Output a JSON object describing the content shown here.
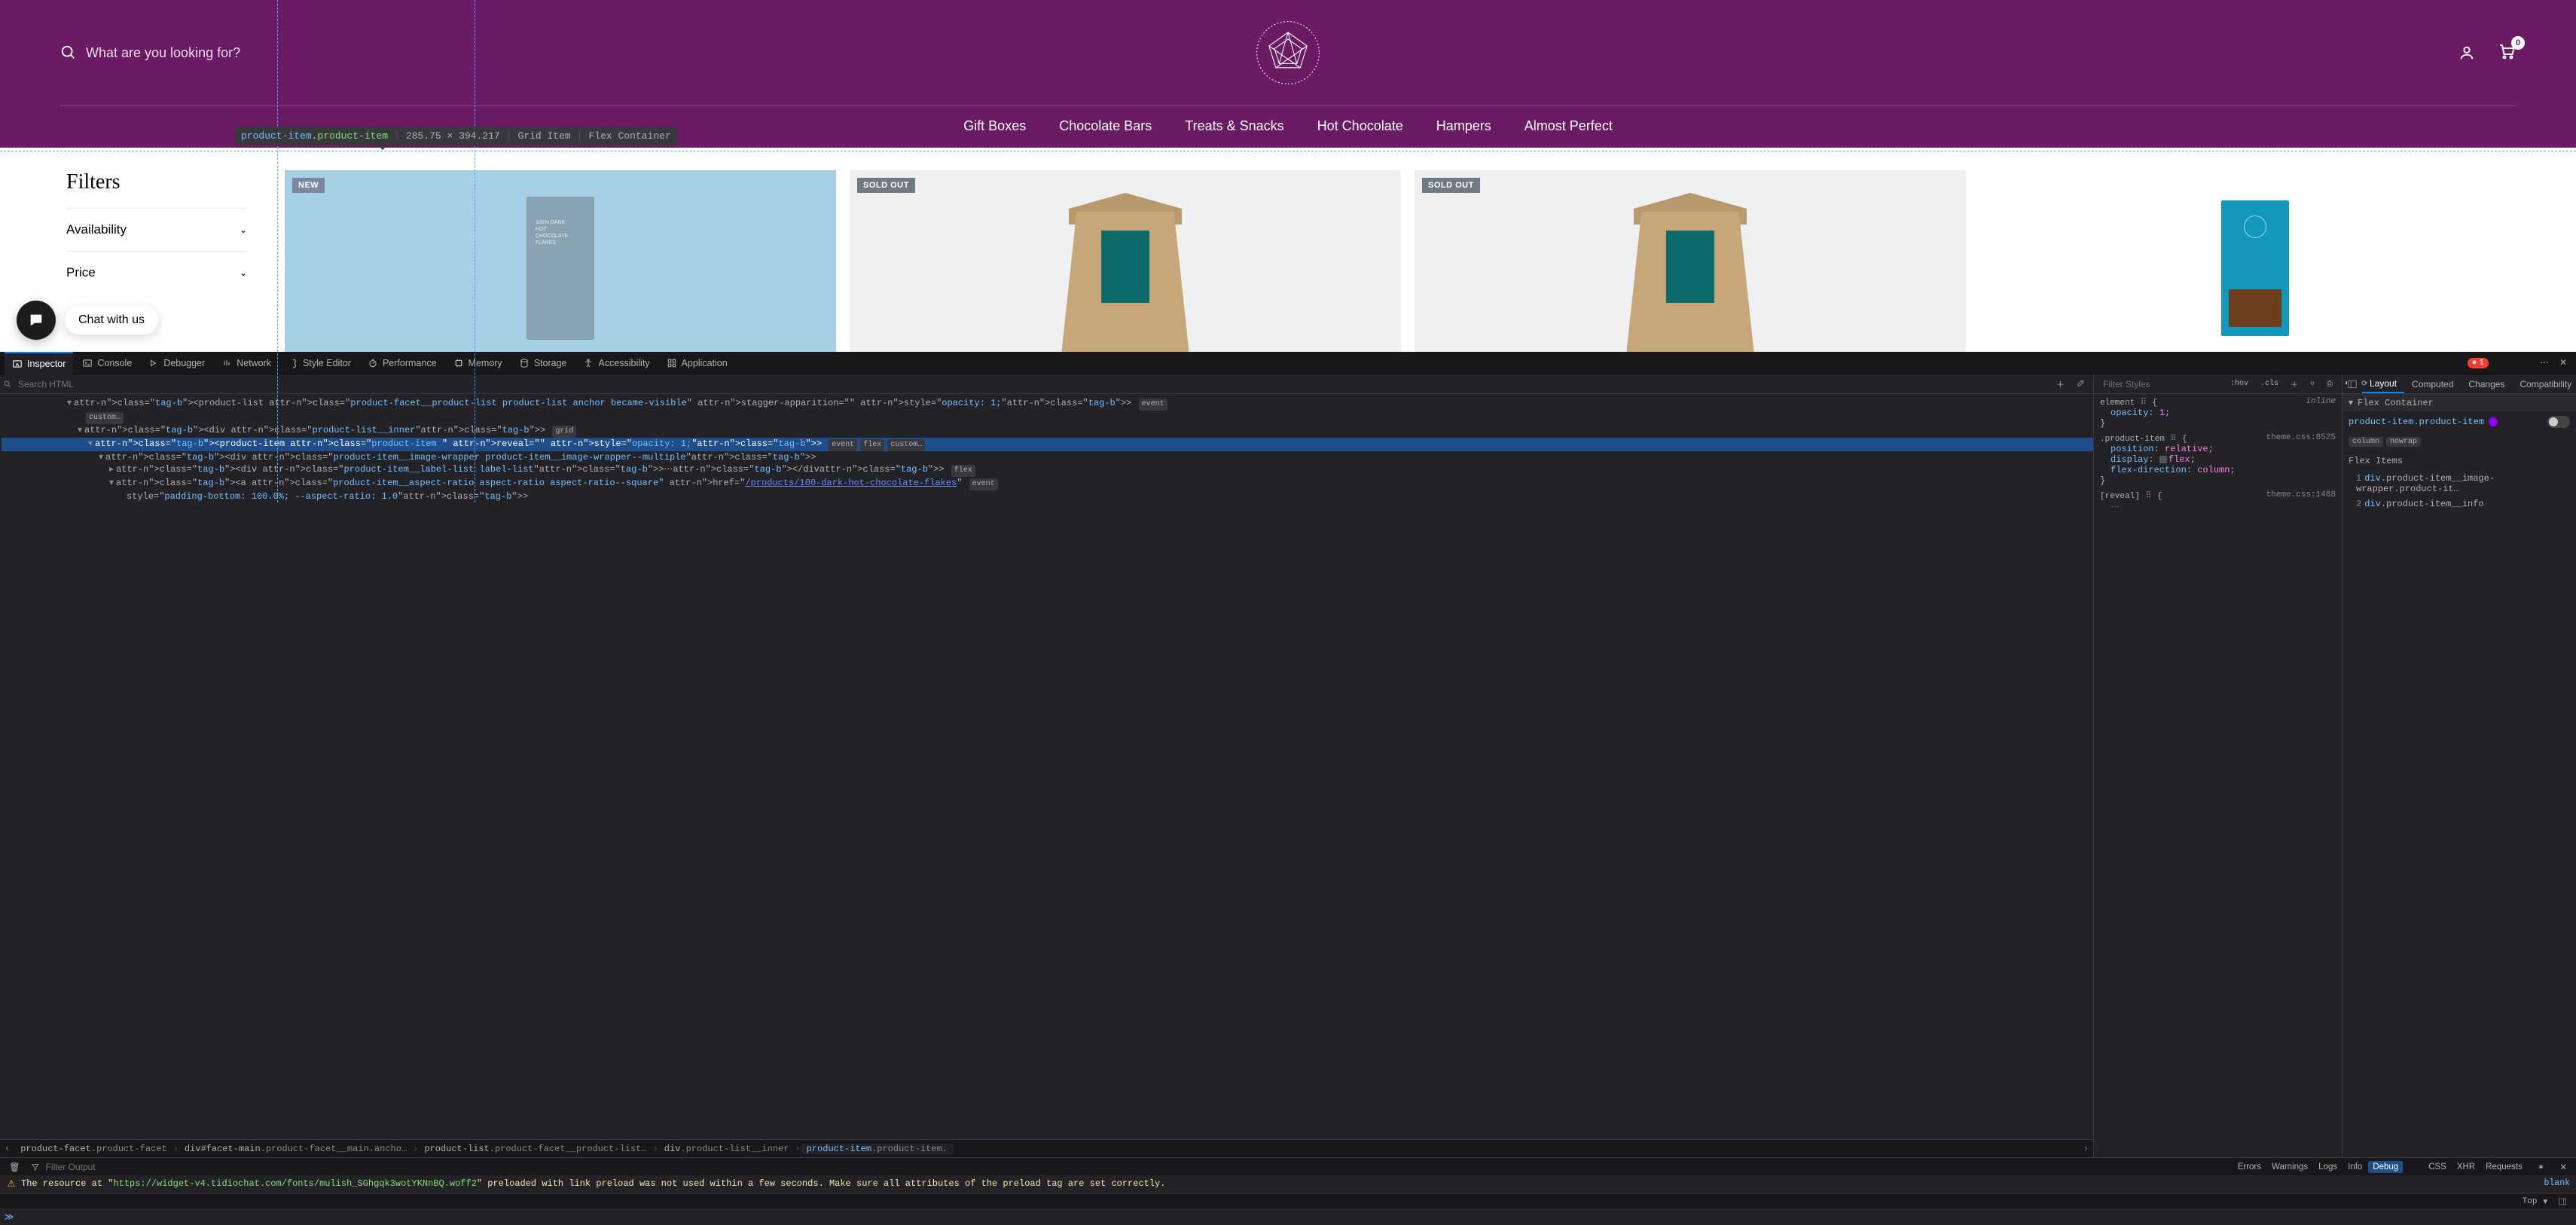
{
  "header": {
    "search_placeholder": "What are you looking for?",
    "cart_count": "0",
    "nav": [
      "Gift Boxes",
      "Chocolate Bars",
      "Treats & Snacks",
      "Hot Chocolate",
      "Hampers",
      "Almost Perfect"
    ]
  },
  "inspect_tip": {
    "tag": "product-item",
    "class": ".product-item",
    "dims": "285.75 × 394.217",
    "role": "Grid Item",
    "layout": "Flex Container"
  },
  "sidebar": {
    "title": "Filters",
    "groups": [
      "Availability",
      "Price"
    ]
  },
  "products": [
    {
      "badge": "NEW",
      "badge_kind": "new",
      "bg": false,
      "highlight": true,
      "kind": "box",
      "box_text": "100% DARK\nHOT\nCHOCOLATE\nFLAKES"
    },
    {
      "badge": "SOLD OUT",
      "badge_kind": "soldout",
      "bg": true,
      "highlight": false,
      "kind": "bag"
    },
    {
      "badge": "SOLD OUT",
      "badge_kind": "soldout",
      "bg": true,
      "highlight": false,
      "kind": "bag"
    },
    {
      "badge": "",
      "badge_kind": "",
      "bg": false,
      "highlight": false,
      "kind": "teal"
    }
  ],
  "chat": {
    "label": "Chat with us"
  },
  "devtools": {
    "tabs": [
      "Inspector",
      "Console",
      "Debugger",
      "Network",
      "Style Editor",
      "Performance",
      "Memory",
      "Storage",
      "Accessibility",
      "Application"
    ],
    "active_tab": "Inspector",
    "error_count": "1",
    "search_html_ph": "Search HTML",
    "filter_styles_ph": "Filter Styles",
    "styles_tools": [
      ":hov",
      ".cls"
    ],
    "dom": [
      {
        "depth": 0,
        "open": "▾",
        "html": "<product-list class=\"product-facet__product-list product-list anchor became-visible\" stagger-apparition=\"\" style=\"opacity: 1;\">",
        "badges": [
          "event"
        ]
      },
      {
        "depth": 1,
        "open": "",
        "html": "",
        "raw_badge": "custom…"
      },
      {
        "depth": 1,
        "open": "▾",
        "html": "<div class=\"product-list__inner\">",
        "badges": [
          "grid"
        ]
      },
      {
        "depth": 2,
        "open": "▾",
        "sel": true,
        "html": "<product-item class=\"product-item \" reveal=\"\" style=\"opacity: 1;\">",
        "badges": [
          "event",
          "flex",
          "custom…"
        ]
      },
      {
        "depth": 3,
        "open": "▾",
        "html": "<div class=\"product-item__image-wrapper product-item__image-wrapper--multiple\">"
      },
      {
        "depth": 4,
        "open": "▸",
        "html": "<div class=\"product-item__label-list label-list\">⋯</div>",
        "badges": [
          "flex"
        ]
      },
      {
        "depth": 4,
        "open": "▾",
        "html_a": true,
        "badges": [
          "event"
        ]
      },
      {
        "depth": 5,
        "open": "",
        "html": "style=\"padding-bottom: 100.0%; --aspect-ratio: 1.0\">"
      }
    ],
    "a_line": {
      "prefix": "<a class=\"product-item__aspect-ratio aspect-ratio aspect-ratio--square\" href=\"",
      "url": "/products/100-dark-hot-chocolate-flakes",
      "suffix": "\""
    },
    "crumbs": [
      {
        "tag": "product-facet",
        "cls": ".product-facet"
      },
      {
        "tag": "div#facet-main",
        "cls": ".product-facet__main.ancho…"
      },
      {
        "tag": "product-list",
        "cls": ".product-facet__product-list…"
      },
      {
        "tag": "div",
        "cls": ".product-list__inner"
      },
      {
        "tag": "product-item",
        "cls": ".product-item.",
        "active": true
      }
    ],
    "rules": [
      {
        "selector": "element",
        "inline": true,
        "props": [
          {
            "n": "opacity",
            "v": "1"
          }
        ],
        "src": "inline"
      },
      {
        "selector": ".product-item",
        "src": "theme.css:8525",
        "props": [
          {
            "n": "position",
            "v": "relative"
          },
          {
            "n": "display",
            "v": "flex",
            "swatch": true
          },
          {
            "n": "flex-direction",
            "v": "column"
          }
        ]
      },
      {
        "selector": "[reveal]",
        "src": "theme.css:1488",
        "props_hidden": true
      }
    ],
    "layout_tabs": [
      "Layout",
      "Computed",
      "Changes",
      "Compatibility"
    ],
    "layout_active": "Layout",
    "flex_section_title": "Flex Container",
    "flex_target": "product-item.product-item",
    "flex_pills": [
      "column",
      "nowrap"
    ],
    "flex_items_title": "Flex Items",
    "flex_items": [
      {
        "n": "1",
        "t": "div",
        "c": ".product-item__image-wrapper.product-it…"
      },
      {
        "n": "2",
        "t": "div",
        "c": ".product-item__info"
      }
    ],
    "console_filter_ph": "Filter Output",
    "console_btns": [
      "Errors",
      "Warnings",
      "Logs",
      "Info",
      "Debug"
    ],
    "console_active_btn": "Debug",
    "console_btns2": [
      "CSS",
      "XHR",
      "Requests"
    ],
    "warn_msg_pre": "The resource at \"",
    "warn_url": "https://widget-v4.tidiochat.com/fonts/mulish_SGhgqk3wotYKNnBQ.woff2",
    "warn_msg_post": "\" preloaded with link preload was not used within a few seconds. Make sure all attributes of the preload tag are set correctly.",
    "warn_src": "blank",
    "top_label": "Top",
    "prompt": "≫"
  }
}
